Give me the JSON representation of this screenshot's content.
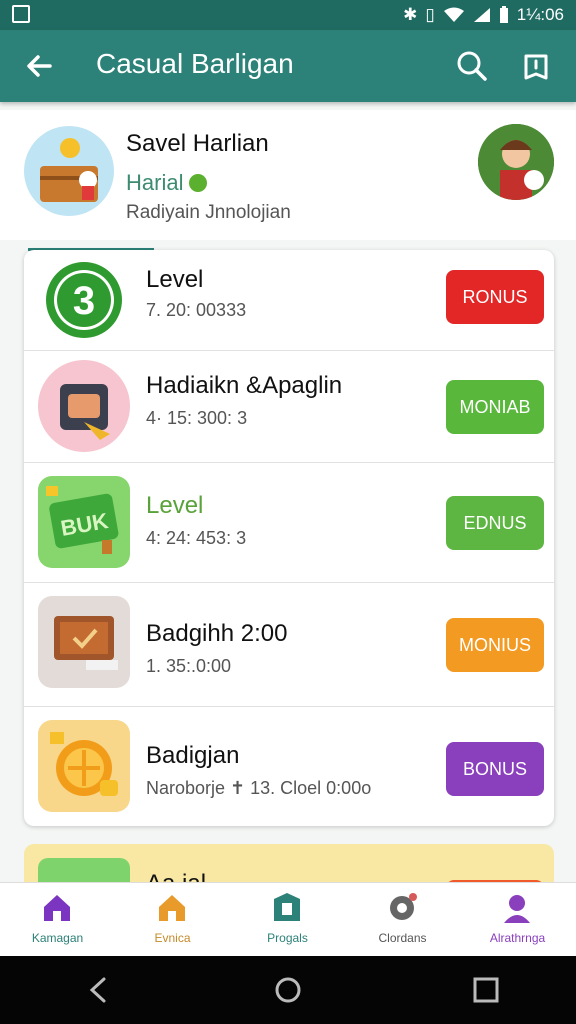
{
  "status_bar": {
    "time": "1¼:06"
  },
  "app_bar": {
    "title": "Casual Barligan"
  },
  "profile": {
    "name": "Savel Harlian",
    "subtitle": "Harial",
    "description": "Radiyain Jnnolojian"
  },
  "rows": [
    {
      "title": "Level",
      "subtitle": "7. 20: 00333",
      "badge": "RONUS",
      "color": "#e32626",
      "icon_text": "3"
    },
    {
      "title": "Hadiaikn &Apaglin",
      "subtitle": "4· 15: 300: 3",
      "badge": "MONIAB",
      "color": "#59b83c"
    },
    {
      "title": "Level",
      "subtitle": "4: 24: 453: 3",
      "badge": "EDNUS",
      "color": "#5db641",
      "icon_text": "BUK"
    },
    {
      "title": "Badgihh 2:00",
      "subtitle": "1. 35:.0:00",
      "badge": "MONIUS",
      "color": "#f39a23"
    },
    {
      "title": "Badigjan",
      "subtitle": "Naroborje ✝ 13. Cloel 0:00o",
      "badge": "BONUS",
      "color": "#8a3fbd"
    }
  ],
  "peek_row": {
    "title": "Aa.ial"
  },
  "bottom_nav": [
    {
      "label": "Kamagan",
      "color": "#7b35c1"
    },
    {
      "label": "Evnica",
      "color": "#e89b2a"
    },
    {
      "label": "Progals",
      "color": "#2c8178"
    },
    {
      "label": "Clordans",
      "color": "#666666"
    },
    {
      "label": "Alrathrnga",
      "color": "#8a3fbd"
    }
  ],
  "colors": {
    "topbar": "#2c8178",
    "statusbar": "#1f6b62",
    "level_green": "#5aa23a"
  },
  "icons": [
    "back-arrow-icon",
    "search-icon",
    "share-icon",
    "home-icon",
    "gear-icon",
    "person-icon"
  ]
}
